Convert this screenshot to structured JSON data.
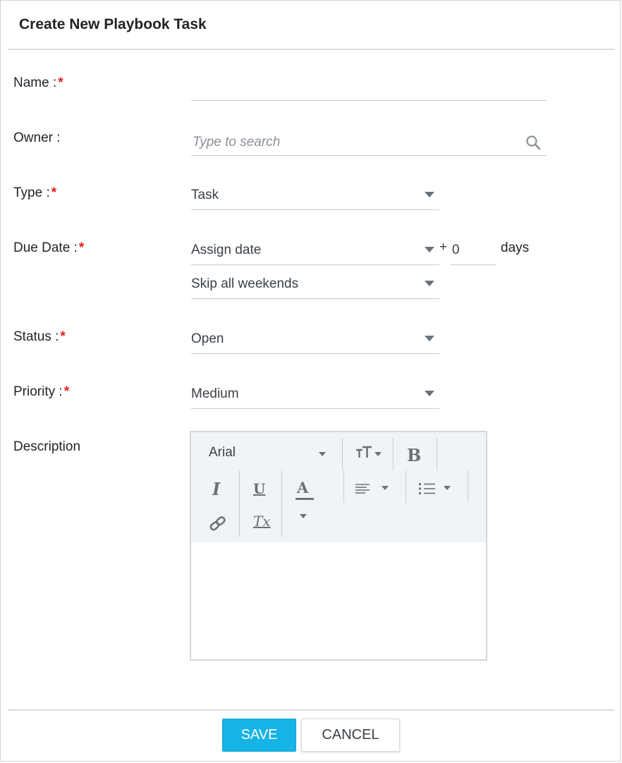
{
  "dialog": {
    "title": "Create New Playbook Task"
  },
  "form": {
    "name": {
      "label": "Name :",
      "required": "*",
      "value": ""
    },
    "owner": {
      "label": "Owner :",
      "placeholder": "Type to search",
      "icon": "search-icon"
    },
    "type": {
      "label": "Type :",
      "required": "*",
      "value": "Task"
    },
    "due_date": {
      "label": "Due Date :",
      "required": "*",
      "value": "Assign date",
      "plus": "+",
      "offset": "0",
      "unit": "days",
      "weekend_rule": "Skip all weekends"
    },
    "status": {
      "label": "Status :",
      "required": "*",
      "value": "Open"
    },
    "priority": {
      "label": "Priority :",
      "required": "*",
      "value": "Medium"
    },
    "description": {
      "label": "Description",
      "toolbar": {
        "font": "Arial",
        "font_size_icon": "text-size-icon",
        "bold_glyph": "B",
        "italic_glyph": "I",
        "underline_glyph": "U",
        "font_color_glyph": "A",
        "align_icon": "align-left-icon",
        "list_icon": "bullet-list-icon",
        "link_icon": "link-icon",
        "clear_format_glyph": "Tx"
      },
      "content": ""
    }
  },
  "actions": {
    "save_label": "SAVE",
    "cancel_label": "CANCEL"
  },
  "colors": {
    "accent": "#16b3e6",
    "required": "#e02020",
    "border": "#d9dcdf",
    "toolbar_bg": "#f1f4f6"
  }
}
